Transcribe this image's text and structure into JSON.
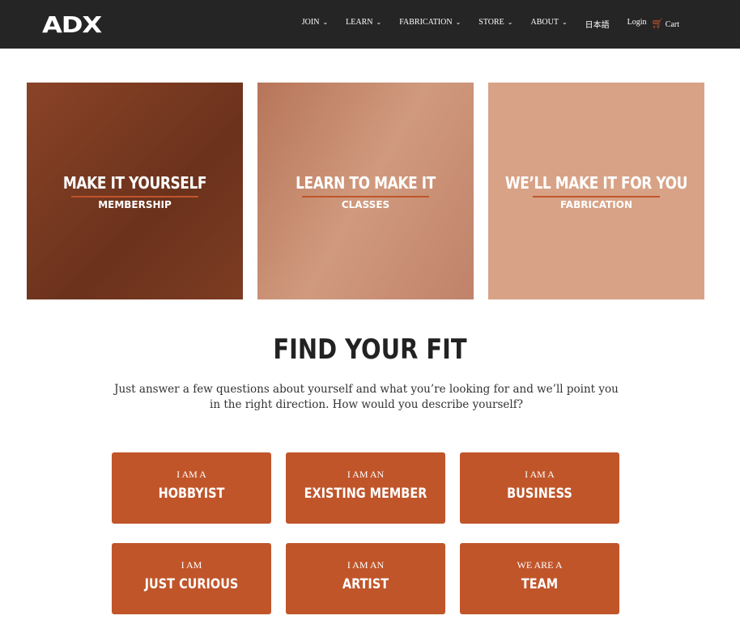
{
  "nav": {
    "logo": "ADX",
    "items": [
      {
        "label": "JOIN"
      },
      {
        "label": "LEARN"
      },
      {
        "label": "FABRICATION"
      },
      {
        "label": "STORE"
      },
      {
        "label": "ABOUT"
      }
    ],
    "japanese": "日本語",
    "login": "Login",
    "cart": "Cart"
  },
  "cards": [
    {
      "title": "MAKE IT YOURSELF",
      "subtitle": "MEMBERSHIP",
      "color": "#7b3b22"
    },
    {
      "title": "LEARN TO MAKE IT",
      "subtitle": "CLASSES",
      "color": "#c58b6f"
    },
    {
      "title": "WE’LL MAKE IT FOR YOU",
      "subtitle": "FABRICATION",
      "color": "#d8a286"
    }
  ],
  "fit": {
    "title": "FIND YOUR FIT",
    "intro": "Just answer a few questions about yourself and what you’re looking for and we’ll point you in the right direction. How would you describe yourself?",
    "options": [
      {
        "pre": "I AM A",
        "label": "HOBBYIST"
      },
      {
        "pre": "I AM AN",
        "label": "EXISTING MEMBER"
      },
      {
        "pre": "I AM A",
        "label": "BUSINESS"
      },
      {
        "pre": "I AM",
        "label": "JUST CURIOUS"
      },
      {
        "pre": "I AM AN",
        "label": "ARTIST"
      },
      {
        "pre": "WE ARE A",
        "label": "TEAM"
      }
    ]
  },
  "colors": {
    "accent": "#c0552a",
    "nav": "#262526"
  }
}
